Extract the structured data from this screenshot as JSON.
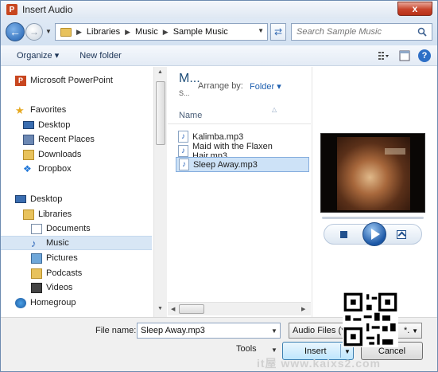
{
  "window": {
    "title": "Insert Audio",
    "app_icon_letter": "P",
    "close_symbol": "x"
  },
  "address": {
    "crumbs": [
      "Libraries",
      "Music",
      "Sample Music"
    ],
    "search_placeholder": "Search Sample Music"
  },
  "toolbar": {
    "organize_label": "Organize",
    "new_folder_label": "New folder"
  },
  "nav": {
    "items": [
      {
        "label": "Microsoft PowerPoint",
        "icon": "powerpoint-icon"
      },
      {
        "label": "Favorites",
        "icon": "star-icon"
      },
      {
        "label": "Desktop",
        "icon": "desktop-icon"
      },
      {
        "label": "Recent Places",
        "icon": "recent-places-icon"
      },
      {
        "label": "Downloads",
        "icon": "downloads-icon"
      },
      {
        "label": "Dropbox",
        "icon": "dropbox-icon"
      },
      {
        "label": "Desktop",
        "icon": "desktop-icon"
      },
      {
        "label": "Libraries",
        "icon": "libraries-icon"
      },
      {
        "label": "Documents",
        "icon": "documents-icon"
      },
      {
        "label": "Music",
        "icon": "music-icon"
      },
      {
        "label": "Pictures",
        "icon": "pictures-icon"
      },
      {
        "label": "Podcasts",
        "icon": "podcasts-icon"
      },
      {
        "label": "Videos",
        "icon": "videos-icon"
      },
      {
        "label": "Homegroup",
        "icon": "homegroup-icon"
      }
    ],
    "selected": "Music"
  },
  "content": {
    "library_title": "M...",
    "library_sub": "S...",
    "arrange_label": "Arrange by:",
    "arrange_value": "Folder",
    "column_name": "Name",
    "files": [
      "Kalimba.mp3",
      "Maid with the Flaxen Hair.mp3",
      "Sleep Away.mp3"
    ],
    "selected_file": "Sleep Away.mp3"
  },
  "bottom": {
    "file_name_label": "File name:",
    "file_name_value": "Sleep Away.mp3",
    "filter_value": "Audio Files (*.*",
    "filter_tail": "*.",
    "tools_label": "Tools",
    "insert_label": "Insert",
    "cancel_label": "Cancel"
  },
  "watermark": "it屋 www.kaixs2.com",
  "colors": {
    "accent": "#1e5fb0",
    "selection": "#cde2f7",
    "close": "#c7432a"
  }
}
